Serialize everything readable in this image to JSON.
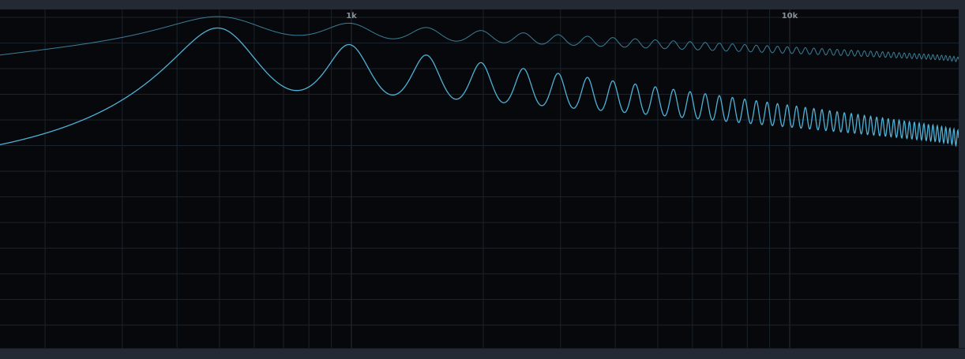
{
  "analyzer": {
    "freq_labels": [
      "1k",
      "10k"
    ],
    "colors": {
      "background": "#06080b",
      "grid": "#1b232c",
      "grid_major": "#28313b",
      "curve": "#4fb2d6",
      "curve_peak": "#3b7f98"
    }
  }
}
